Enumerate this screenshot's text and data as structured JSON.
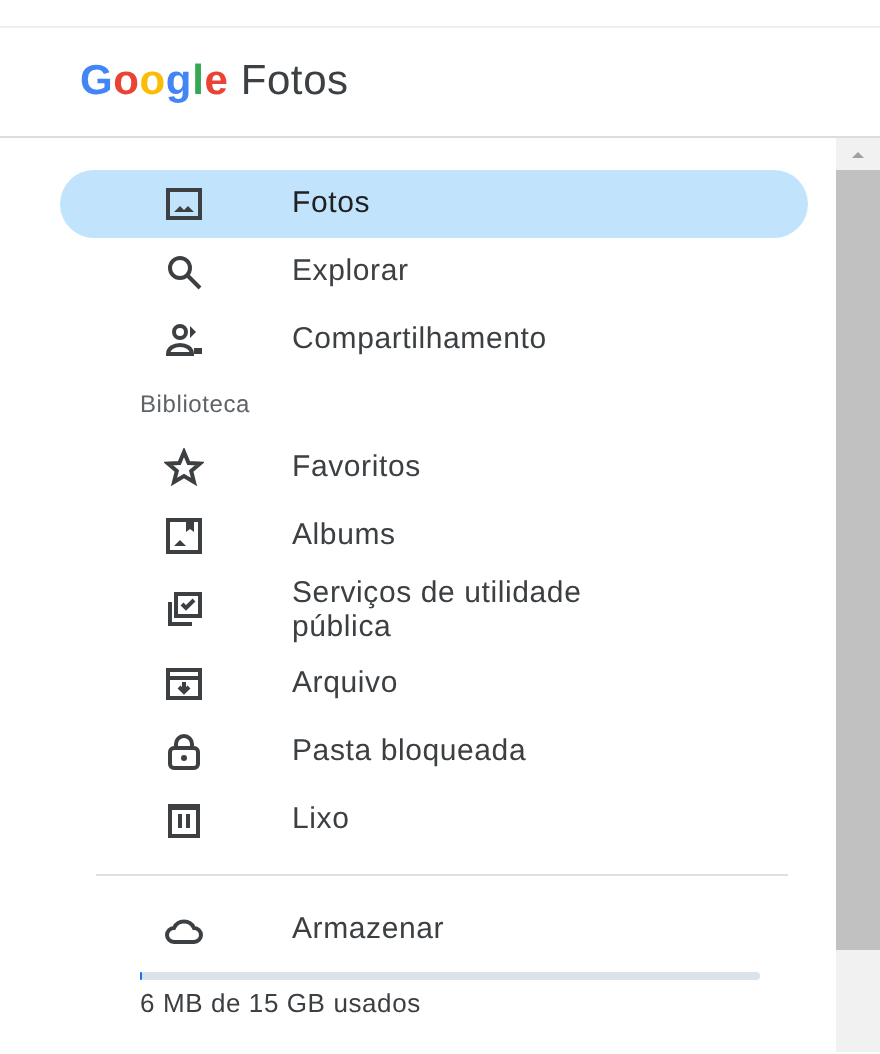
{
  "header": {
    "brand": "Google",
    "product": "Fotos"
  },
  "nav": [
    {
      "label": "Fotos",
      "selected": true
    },
    {
      "label": "Explorar",
      "selected": false
    },
    {
      "label": "Compartilhamento",
      "selected": false
    }
  ],
  "library": {
    "heading": "Biblioteca",
    "items": [
      {
        "label": "Favoritos",
        "selected": false
      },
      {
        "label": "Albums",
        "selected": false
      },
      {
        "label": "Serviços de utilidade pública",
        "selected": false
      },
      {
        "label": "Arquivo",
        "selected": false
      },
      {
        "label": "Pasta bloqueada",
        "selected": false
      },
      {
        "label": "Lixo",
        "selected": false
      }
    ]
  },
  "storage": {
    "label": "Armazenar",
    "level": 0.0004,
    "usage": "6 MB de 15 GB usados"
  }
}
